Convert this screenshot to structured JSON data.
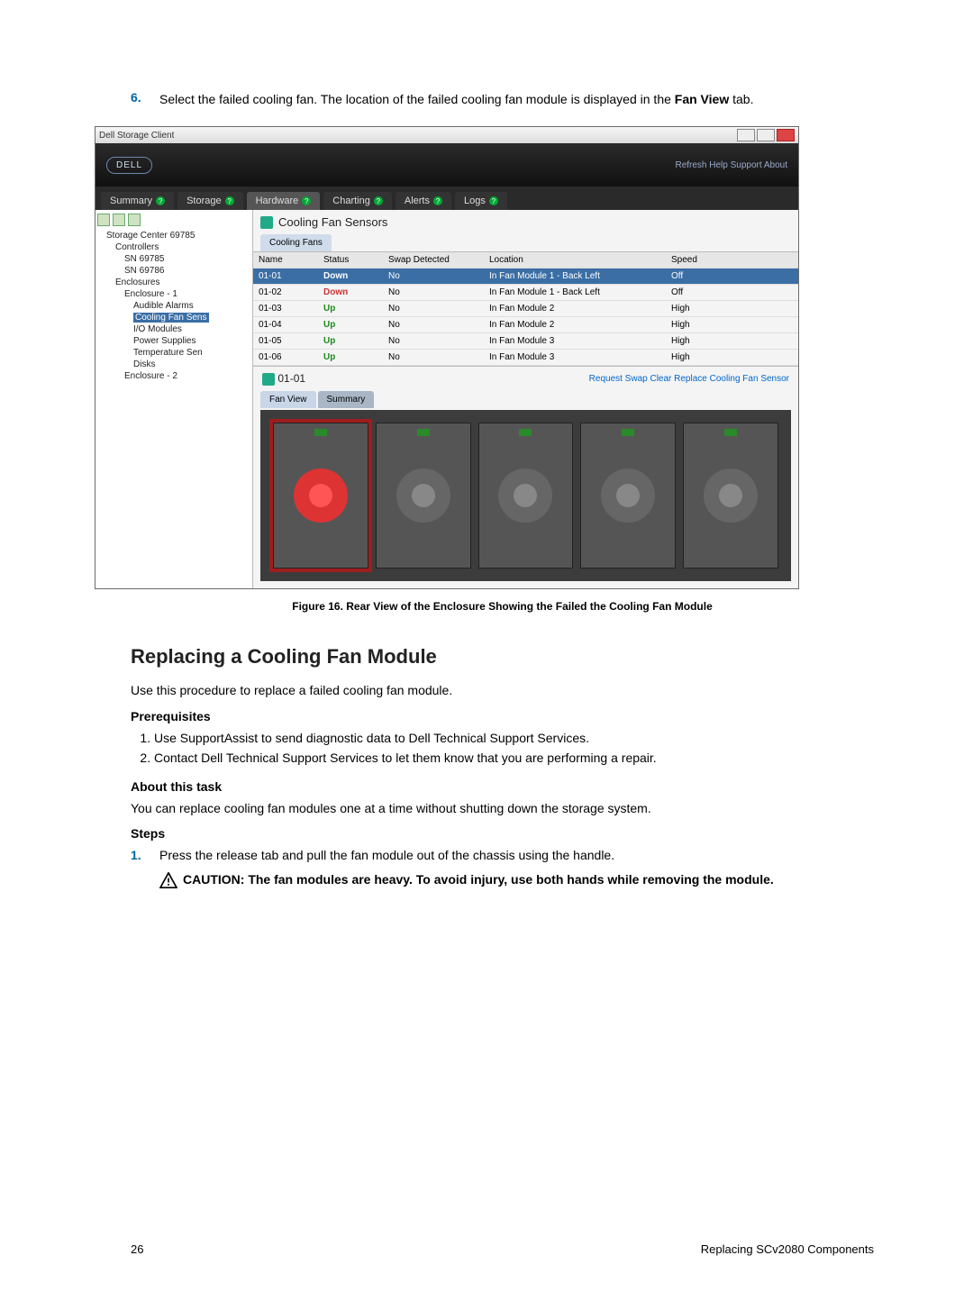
{
  "step6": {
    "num": "6.",
    "text_a": "Select the failed cooling fan. The location of the failed cooling fan module is displayed in the ",
    "bold1": "Fan View",
    "text_b": " tab."
  },
  "win": {
    "title": "Dell Storage Client",
    "banner_links": "Refresh  Help  Support  About",
    "logo": "DELL",
    "tabs": [
      "Summary",
      "Storage",
      "Hardware",
      "Charting",
      "Alerts",
      "Logs"
    ],
    "tree_root": "Storage Center 69785",
    "tree": {
      "controllers": "Controllers",
      "sn1": "SN 69785",
      "sn2": "SN 69786",
      "enclosures": "Enclosures",
      "enc1": "Enclosure - 1",
      "audible": "Audible Alarms",
      "cooling": "Cooling Fan Sens",
      "io": "I/O Modules",
      "power": "Power Supplies",
      "temp": "Temperature Sen",
      "disks": "Disks",
      "enc2": "Enclosure - 2"
    },
    "pane_title": "Cooling Fan Sensors",
    "sub_tab": "Cooling Fans",
    "columns": {
      "name": "Name",
      "status": "Status",
      "swap": "Swap Detected",
      "loc": "Location",
      "speed": "Speed"
    },
    "rows": [
      {
        "name": "01-01",
        "status": "Down",
        "swap": "No",
        "loc": "In Fan Module 1 - Back Left",
        "speed": "Off",
        "sel": true,
        "down": true
      },
      {
        "name": "01-02",
        "status": "Down",
        "swap": "No",
        "loc": "In Fan Module 1 - Back Left",
        "speed": "Off",
        "sel": false,
        "down": true
      },
      {
        "name": "01-03",
        "status": "Up",
        "swap": "No",
        "loc": "In Fan Module 2",
        "speed": "High",
        "sel": false,
        "down": false
      },
      {
        "name": "01-04",
        "status": "Up",
        "swap": "No",
        "loc": "In Fan Module 2",
        "speed": "High",
        "sel": false,
        "down": false
      },
      {
        "name": "01-05",
        "status": "Up",
        "swap": "No",
        "loc": "In Fan Module 3",
        "speed": "High",
        "sel": false,
        "down": false
      },
      {
        "name": "01-06",
        "status": "Up",
        "swap": "No",
        "loc": "In Fan Module 3",
        "speed": "High",
        "sel": false,
        "down": false
      }
    ],
    "detail_title": "01-01",
    "detail_actions": "Request Swap Clear   Replace Cooling Fan Sensor",
    "detail_tabs": {
      "fan": "Fan View",
      "summary": "Summary"
    }
  },
  "figure_caption": "Figure 16. Rear View of the Enclosure Showing the Failed the Cooling Fan Module",
  "section_title": "Replacing a Cooling Fan Module",
  "intro": "Use this procedure to replace a failed cooling fan module.",
  "prereq_head": "Prerequisites",
  "prereq": [
    "Use SupportAssist to send diagnostic data to Dell Technical Support Services.",
    "Contact Dell Technical Support Services to let them know that you are performing a repair."
  ],
  "about_head": "About this task",
  "about_text": "You can replace cooling fan modules one at a time without shutting down the storage system.",
  "steps_head": "Steps",
  "step1": {
    "num": "1.",
    "text": "Press the release tab and pull the fan module out of the chassis using the handle."
  },
  "caution": "CAUTION: The fan modules are heavy. To avoid injury, use both hands while removing the module.",
  "footer_page": "26",
  "footer_right": "Replacing SCv2080 Components"
}
